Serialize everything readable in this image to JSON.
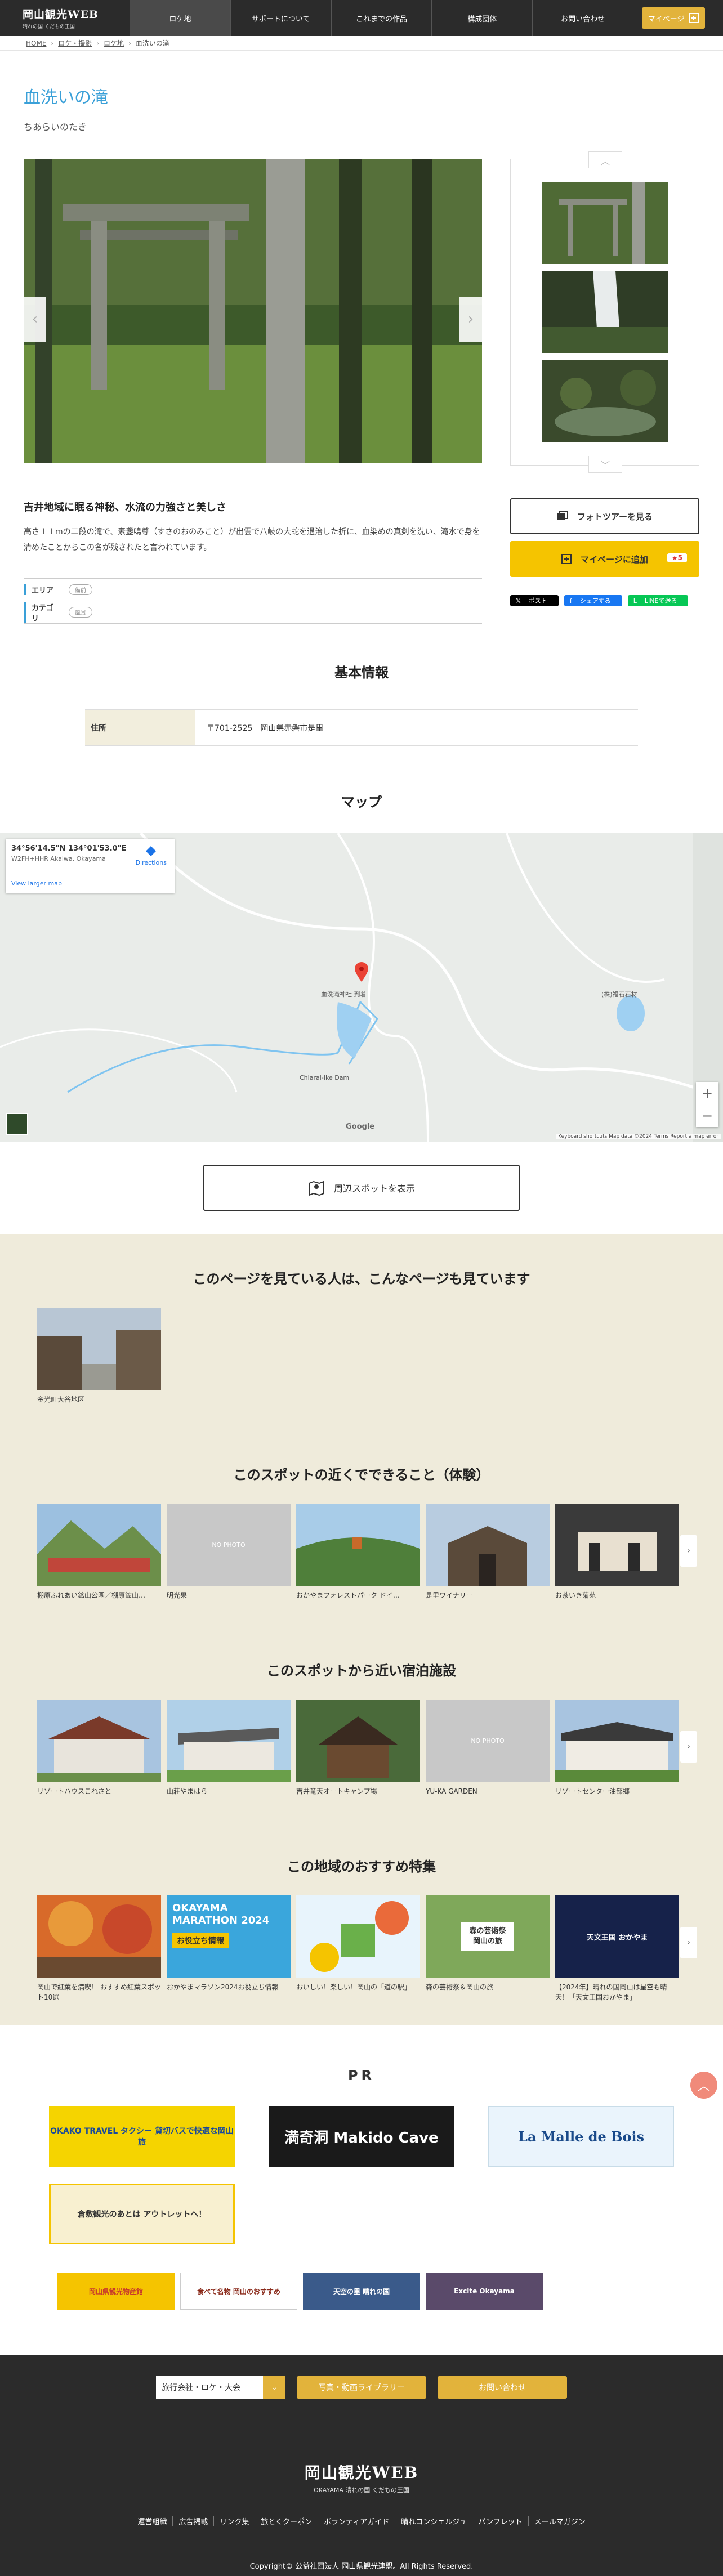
{
  "header": {
    "logo_title": "岡山観光WEB",
    "logo_sub": "晴れの国 くだもの王国",
    "nav": [
      "ロケ地",
      "サポートについて",
      "これまでの作品",
      "構成団体",
      "お問い合わせ"
    ],
    "mypage": "マイページ"
  },
  "breadcrumb": [
    "HOME",
    "ロケ・撮影",
    "ロケ地",
    "血洗いの滝"
  ],
  "spot": {
    "title": "血洗いの滝",
    "kana": "ちあらいのたき",
    "heading": "吉井地域に眠る神秘、水流の力強さと美しさ",
    "description": "高さ１１mの二段の滝で、素盞鳴尊（すさのおのみこと）が出雲で八岐の大蛇を退治した折に、血染めの真剣を洗い、滝水で身を清めたことからこの名が残されたと言われています。",
    "area_label": "エリア",
    "area_tag": "備前",
    "category_label": "カテゴリ",
    "category_tag": "風景"
  },
  "actions": {
    "phototour": "フォトツアーを見る",
    "add_mypage": "マイページに追加",
    "count": "5",
    "post": "ポスト",
    "share": "シェアする",
    "line": "LINEで送る"
  },
  "basic": {
    "title": "基本情報",
    "label": "住所",
    "value": "〒701-2525　岡山県赤磐市是里"
  },
  "map": {
    "title": "マップ",
    "coords": "34°56'14.5\"N 134°01'53.0\"E",
    "plus": "W2FH+HHR Akaiwa, Okayama",
    "larger": "View larger map",
    "directions": "Directions",
    "place1": "血洗滝神社 到着",
    "place2": "Chiarai-Ike Dam",
    "place3": "(株)福石石材",
    "attrib": "Keyboard shortcuts   Map data ©2024   Terms   Report a map error",
    "google": "Google"
  },
  "near_button": "周辺スポットを表示",
  "sections": [
    {
      "title": "このページを見ている人は、こんなページも見ています",
      "items": [
        "金光町大谷地区"
      ]
    },
    {
      "title": "このスポットの近くでできること（体験）",
      "items": [
        "棚原ふれあい鉱山公園／棚原鉱山…",
        "明光果",
        "おかやまフォレストパーク ドイ…",
        "是里ワイナリー",
        "お茶いき菊苑"
      ]
    },
    {
      "title": "このスポットから近い宿泊施設",
      "items": [
        "リゾートハウスこれさと",
        "山荘やまはら",
        "吉井竜天オートキャンプ場",
        "YU-KA GARDEN",
        "リゾートセンター油部郷"
      ]
    },
    {
      "title": "この地域のおすすめ特集",
      "items": [
        "岡山で紅葉を満喫！ おすすめ紅葉スポット10選",
        "おかやまマラソン2024お役立ち情報",
        "おいしい！楽しい！岡山の「道の駅」",
        "森の芸術祭＆岡山の旅",
        "【2024年】晴れの国岡山は星空も晴天！「天文王国おかやま」"
      ]
    }
  ],
  "card_texts": {
    "nophoto": "NO PHOTO",
    "marathon_1": "OKAYAMA MARATHON 2024",
    "marathon_2": "お役立ち情報",
    "forest_1": "森の芸術祭",
    "forest_2": "岡山の旅",
    "tenmon": "天文王国 おかやま"
  },
  "pr": {
    "title": "PR",
    "banners": [
      "OKAKO TRAVEL タクシー 貸切バスで快適な岡山旅",
      "満奇洞 Makido Cave",
      "La Malle de Bois",
      "倉敷観光のあとは アウトレットへ！"
    ],
    "small": [
      "岡山県観光物産館",
      "食べて名物 岡山のおすすめ",
      "天空の里 晴れの国",
      "Excite Okayama"
    ]
  },
  "footer": {
    "select": "旅行会社・ロケ・大会",
    "library": "写真・動画ライブラリー",
    "contact": "お問い合わせ",
    "logo_title": "岡山観光WEB",
    "logo_sub": "OKAYAMA 晴れの国 くだもの王国",
    "links": [
      "運営組織",
      "広告掲載",
      "リンク集",
      "旅とくクーポン",
      "ボランティアガイド",
      "晴れコンシェルジュ",
      "パンフレット",
      "メールマガジン"
    ],
    "copyright": "Copyright© 公益社団法人 岡山県観光連盟。All Rights Reserved."
  }
}
